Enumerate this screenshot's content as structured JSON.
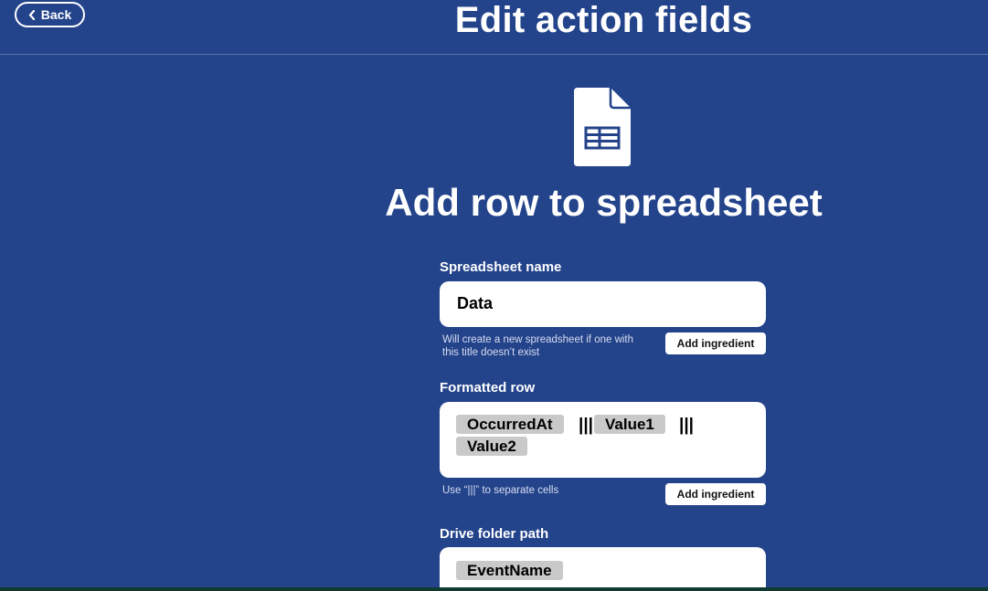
{
  "header": {
    "back_label": "Back",
    "title": "Edit action fields"
  },
  "action": {
    "icon": "spreadsheet-icon",
    "title": "Add row to spreadsheet"
  },
  "fields": {
    "spreadsheet_name": {
      "label": "Spreadsheet name",
      "value": "Data",
      "helper": "Will create a new spreadsheet if one with this title doesn’t exist",
      "add_ingredient_label": "Add ingredient"
    },
    "formatted_row": {
      "label": "Formatted row",
      "tokens": [
        "OccurredAt",
        "Value1",
        "Value2"
      ],
      "separator": "|||",
      "helper": "Use “|||” to separate cells",
      "add_ingredient_label": "Add ingredient"
    },
    "drive_folder_path": {
      "label": "Drive folder path",
      "tokens": [
        "EventName"
      ]
    }
  },
  "colors": {
    "background": "#23438b",
    "pill": "#c9c9c9",
    "accent_white": "#ffffff"
  }
}
